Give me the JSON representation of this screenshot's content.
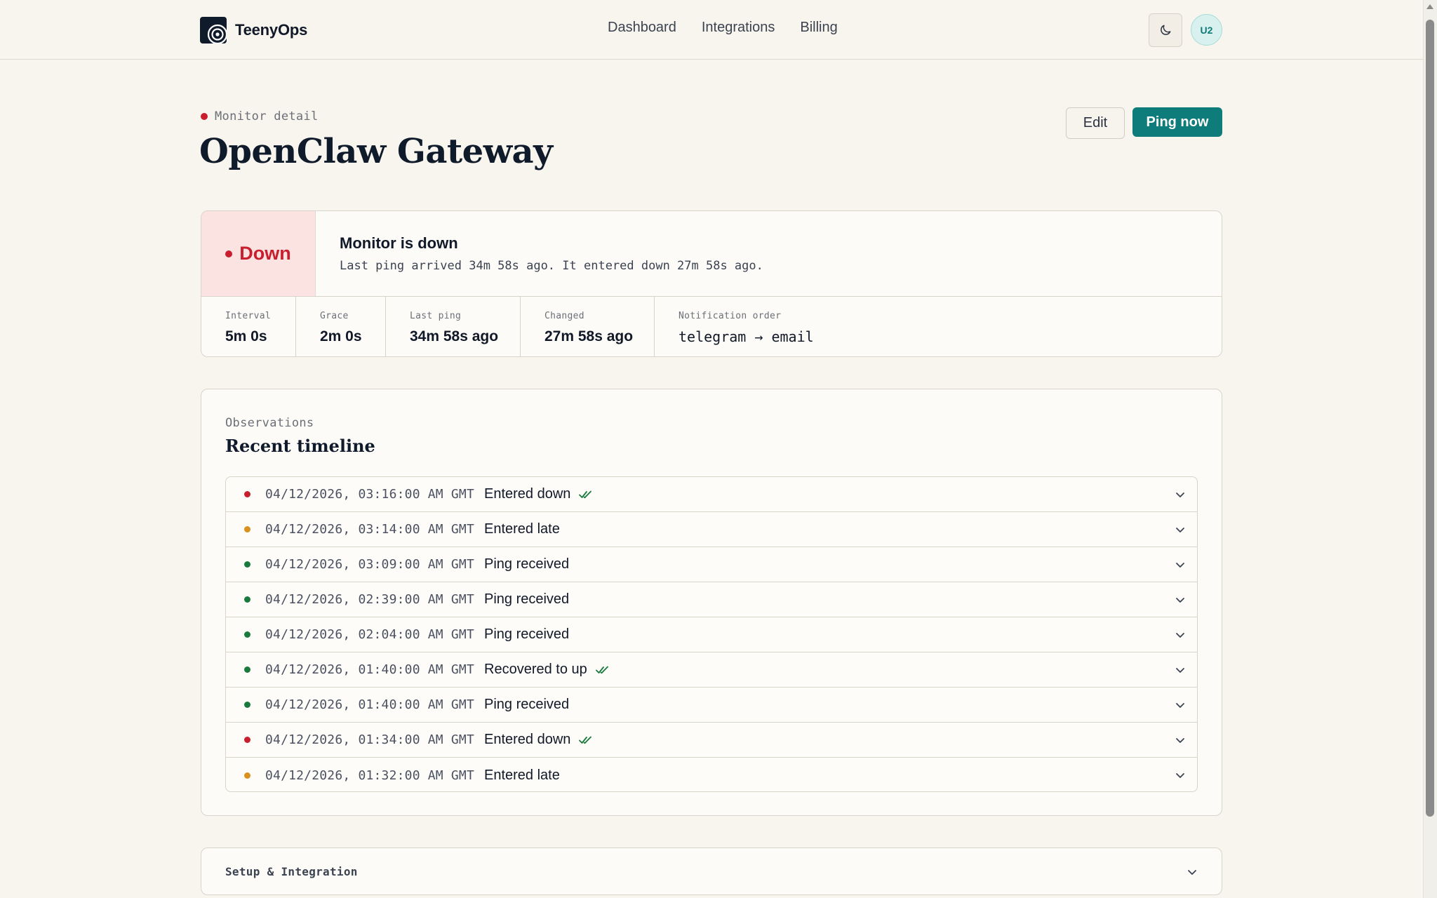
{
  "app": {
    "name": "TeenyOps"
  },
  "nav": {
    "items": [
      "Dashboard",
      "Integrations",
      "Billing"
    ]
  },
  "header": {
    "avatar_initials": "U2"
  },
  "page": {
    "eyebrow": "Monitor detail",
    "title": "OpenClaw Gateway",
    "edit_label": "Edit",
    "ping_label": "Ping now"
  },
  "status": {
    "state": "Down",
    "heading": "Monitor is down",
    "description": "Last ping arrived 34m 58s ago. It entered down 27m 58s ago.",
    "stats": [
      {
        "label": "Interval",
        "value": "5m 0s"
      },
      {
        "label": "Grace",
        "value": "2m 0s"
      },
      {
        "label": "Last ping",
        "value": "34m 58s ago"
      },
      {
        "label": "Changed",
        "value": "27m 58s ago"
      },
      {
        "label": "Notification order",
        "value": "telegram → email"
      }
    ]
  },
  "timeline": {
    "eyebrow": "Observations",
    "title": "Recent timeline",
    "rows": [
      {
        "time": "04/12/2026, 03:16:00 AM GMT",
        "event": "Entered down",
        "status": "down",
        "notified": true
      },
      {
        "time": "04/12/2026, 03:14:00 AM GMT",
        "event": "Entered late",
        "status": "late",
        "notified": false
      },
      {
        "time": "04/12/2026, 03:09:00 AM GMT",
        "event": "Ping received",
        "status": "up",
        "notified": false
      },
      {
        "time": "04/12/2026, 02:39:00 AM GMT",
        "event": "Ping received",
        "status": "up",
        "notified": false
      },
      {
        "time": "04/12/2026, 02:04:00 AM GMT",
        "event": "Ping received",
        "status": "up",
        "notified": false
      },
      {
        "time": "04/12/2026, 01:40:00 AM GMT",
        "event": "Recovered to up",
        "status": "up",
        "notified": true
      },
      {
        "time": "04/12/2026, 01:40:00 AM GMT",
        "event": "Ping received",
        "status": "up",
        "notified": false
      },
      {
        "time": "04/12/2026, 01:34:00 AM GMT",
        "event": "Entered down",
        "status": "down",
        "notified": true
      },
      {
        "time": "04/12/2026, 01:32:00 AM GMT",
        "event": "Entered late",
        "status": "late",
        "notified": false
      }
    ]
  },
  "setup": {
    "label": "Setup & Integration"
  },
  "colors": {
    "down": "#c81e2e",
    "late": "#d9901c",
    "up": "#1a7a3e",
    "accent": "#0e7c7b"
  }
}
